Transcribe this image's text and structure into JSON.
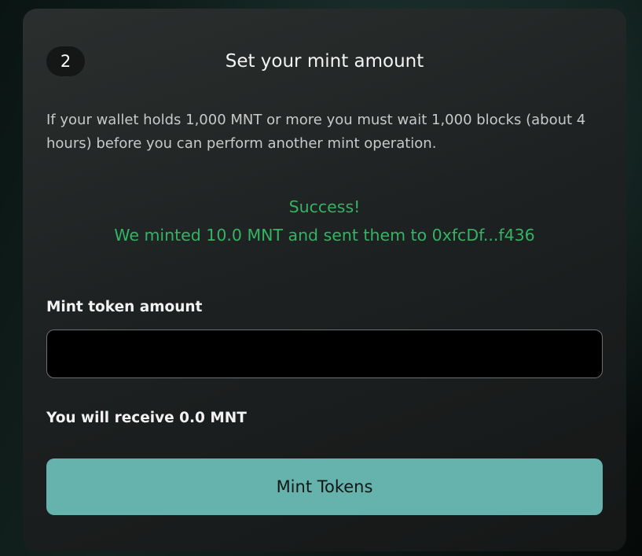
{
  "step": {
    "number": "2",
    "title": "Set your mint amount"
  },
  "description": "If your wallet holds 1,000 MNT or more you must wait 1,000 blocks (about 4 hours) before you can perform another mint operation.",
  "status": {
    "headline": "Success!",
    "message": "We minted 10.0 MNT and sent them to 0xfcDf...f436",
    "color": "#35b364"
  },
  "form": {
    "amount_label": "Mint token amount",
    "amount_value": "",
    "amount_placeholder": "",
    "receive_text": "You will receive 0.0 MNT",
    "submit_label": "Mint Tokens",
    "submit_color": "#66b3ad"
  }
}
